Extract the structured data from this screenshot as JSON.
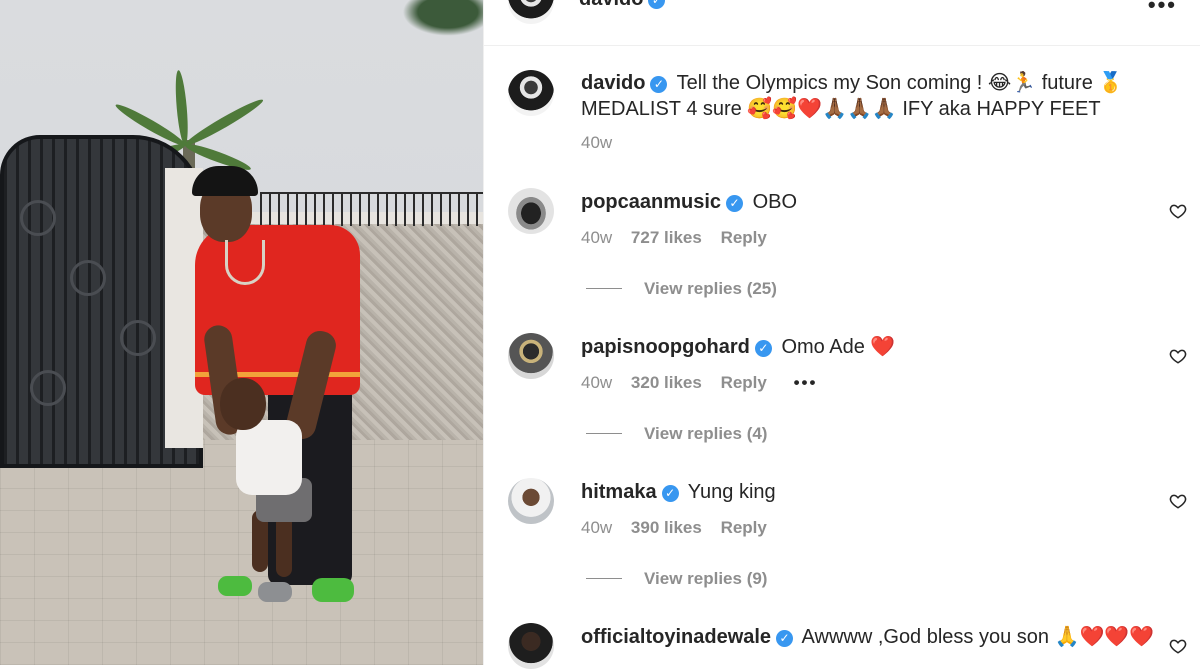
{
  "header": {
    "username": "davido",
    "more_label": "•••"
  },
  "caption": {
    "username": "davido",
    "text": "Tell the Olympics my Son coming ! 😂🏃 future 🥇 MEDALIST 4 sure 🥰🥰❤️🙏🏾🙏🏾🙏🏾 IFY aka HAPPY FEET",
    "time": "40w"
  },
  "comments": [
    {
      "username": "popcaanmusic",
      "text": "OBO",
      "time": "40w",
      "likes": "727 likes",
      "reply": "Reply",
      "view_replies": "View replies (25)"
    },
    {
      "username": "papisnoopgohard",
      "text": "Omo Ade ❤️",
      "time": "40w",
      "likes": "320 likes",
      "reply": "Reply",
      "more": "•••",
      "view_replies": "View replies (4)"
    },
    {
      "username": "hitmaka",
      "text": "Yung king",
      "time": "40w",
      "likes": "390 likes",
      "reply": "Reply",
      "view_replies": "View replies (9)"
    },
    {
      "username": "officialtoyinadewale",
      "text": "Awwww ,God bless you son 🙏❤️❤️❤️"
    }
  ],
  "icons": {
    "verified": "verified-badge-icon",
    "like": "heart-outline-icon",
    "more": "more-horizontal-icon"
  },
  "colors": {
    "verified_blue": "#3897f0",
    "muted_text": "#8e8e8e",
    "primary_text": "#262626"
  }
}
